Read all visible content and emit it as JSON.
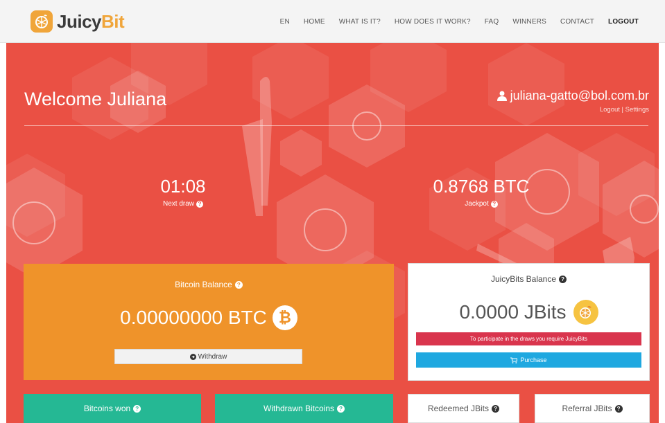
{
  "brand": {
    "name_part1": "Juicy",
    "name_part2": "Bit"
  },
  "nav": {
    "items": [
      "EN",
      "HOME",
      "WHAT IS IT?",
      "HOW DOES IT WORK?",
      "FAQ",
      "WINNERS",
      "CONTACT"
    ],
    "logout": "LOGOUT"
  },
  "hero": {
    "welcome": "Welcome Juliana",
    "email": "juliana-gatto@bol.com.br",
    "links": {
      "logout": "Logout",
      "separator": " | ",
      "settings": "Settings"
    },
    "next_draw": {
      "value": "01:08",
      "label": "Next draw"
    },
    "jackpot": {
      "value": "0.8768 BTC",
      "label": "Jackpot"
    }
  },
  "bitcoin_balance": {
    "title": "Bitcoin Balance",
    "amount": "0.00000000 BTC",
    "coin_symbol": "₿",
    "withdraw_label": "Withdraw"
  },
  "juicybits_balance": {
    "title": "JuicyBits Balance",
    "amount": "0.0000 JBits",
    "alert": "To participate in the draws you require JuicyBits",
    "purchase_label": "Purchase"
  },
  "stats": {
    "bitcoins_won": "Bitcoins won",
    "withdrawn_bitcoins": "Withdrawn Bitcoins",
    "redeemed_jbits": "Redeemed JBits",
    "referral_jbits": "Referral JBits"
  },
  "colors": {
    "hero_red": "#ea5044",
    "orange": "#ef932a",
    "green": "#25b894",
    "alert_red": "#d9354d",
    "blue": "#1fa8e0"
  }
}
